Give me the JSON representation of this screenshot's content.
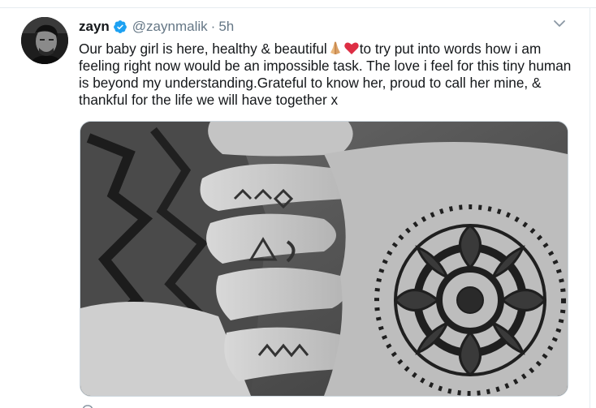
{
  "tweet": {
    "author": {
      "display_name": "zayn",
      "handle": "@zaynmalik",
      "verified": true,
      "avatar_icon": "profile-photo"
    },
    "separator": "·",
    "time": "5h",
    "menu_icon": "chevron-down-icon",
    "text_part1": "Our baby girl is here, healthy & beautiful",
    "emojis": [
      "folded-hands-emoji",
      "red-heart-emoji"
    ],
    "text_part2": "to try put into words how i am feeling right now would be an impossible task. The love i feel for this tiny human is beyond my understanding.Grateful to know her, proud to call her mine, & thankful for the life we will have together x",
    "media": {
      "type": "photo",
      "subject": "black-and-white photo of tattooed hands"
    }
  },
  "colors": {
    "text_primary": "#14171a",
    "text_secondary": "#657786",
    "verified_blue": "#1da1f2",
    "border": "#e6ecf0",
    "heart_red": "#dd2e44"
  }
}
